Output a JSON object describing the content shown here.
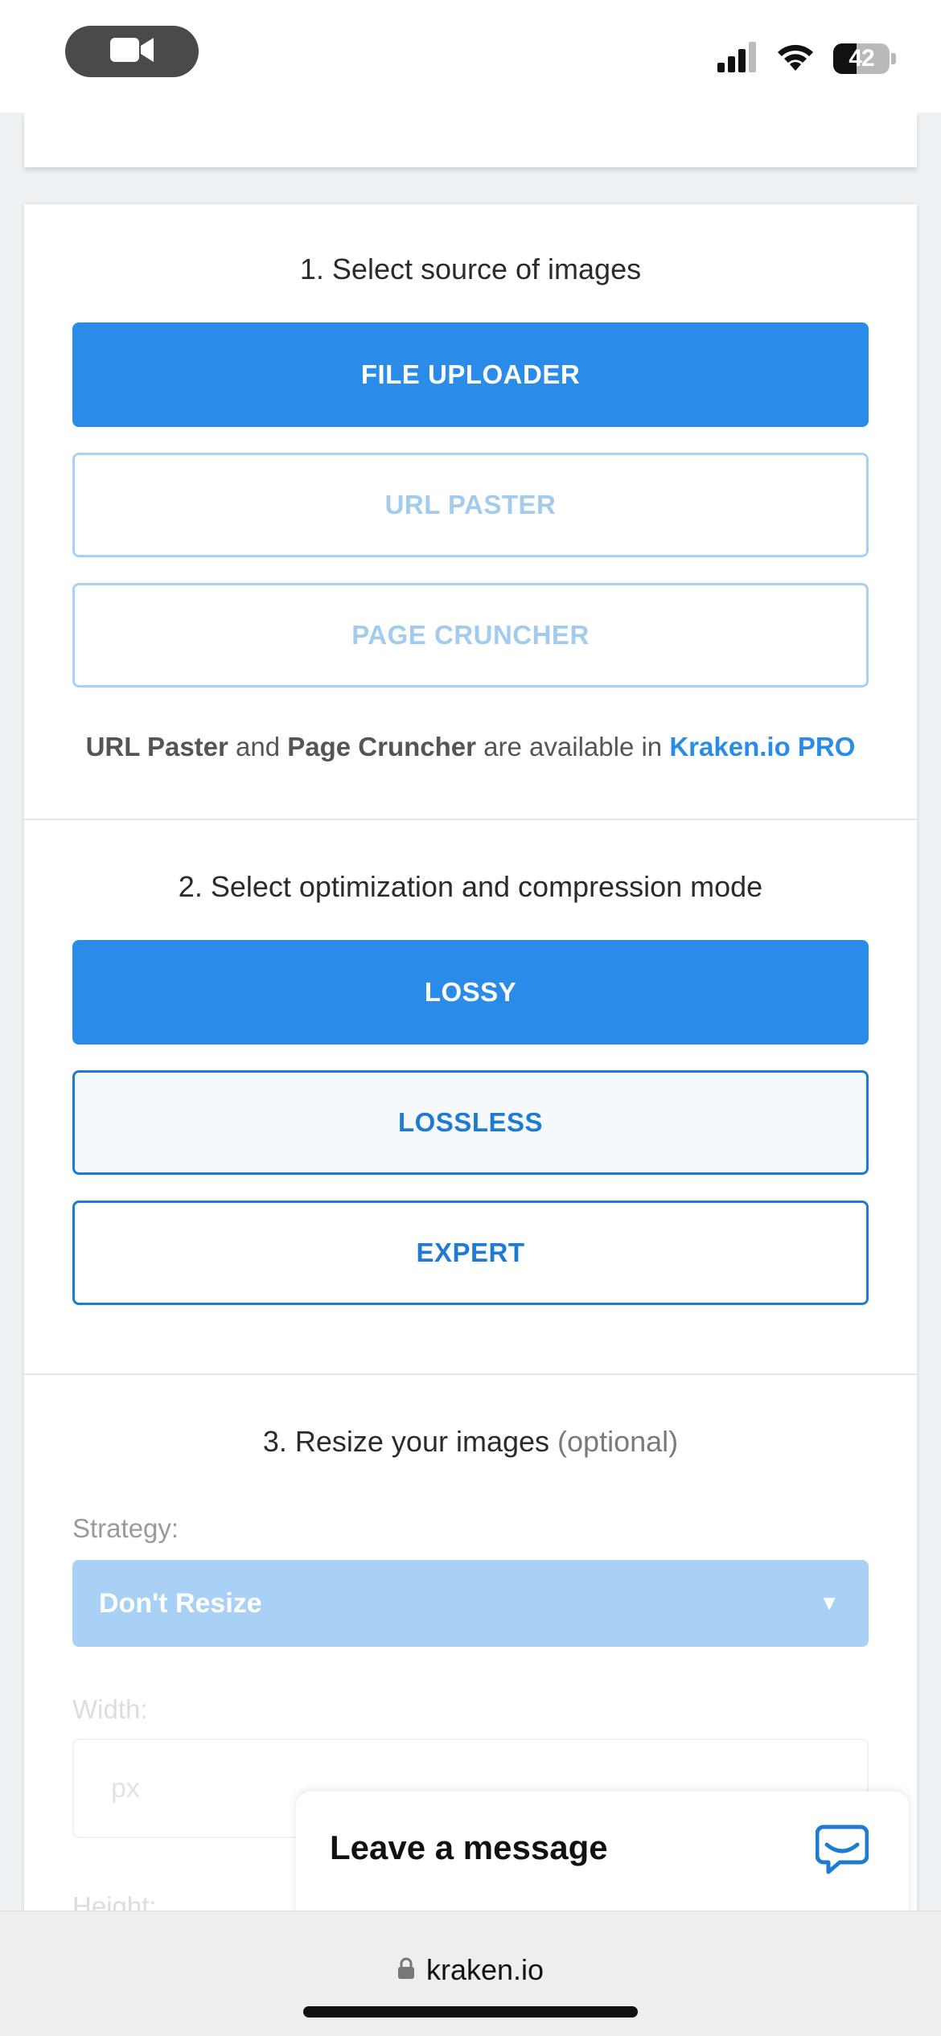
{
  "status_bar": {
    "battery_level": "42",
    "icons": [
      "video-camera-icon",
      "cellular-signal-icon",
      "wifi-icon",
      "battery-icon"
    ]
  },
  "section1": {
    "title": "1. Select source of images",
    "buttons": [
      "FILE UPLOADER",
      "URL PASTER",
      "PAGE CRUNCHER"
    ],
    "note_part1": "URL Paster",
    "note_part2": " and ",
    "note_part3": "Page Cruncher",
    "note_part4": " are available in ",
    "note_link": "Kraken.io PRO"
  },
  "section2": {
    "title": "2. Select optimization and compression mode",
    "buttons": [
      "LOSSY",
      "LOSSLESS",
      "EXPERT"
    ]
  },
  "section3": {
    "title": "3. Resize your images",
    "title_optional": "(optional)",
    "strategy_label": "Strategy:",
    "strategy_value": "Don't Resize",
    "width_label": "Width:",
    "width_placeholder": "px",
    "height_label": "Height:"
  },
  "chat": {
    "label": "Leave a message"
  },
  "browser": {
    "url": "kraken.io"
  },
  "colors": {
    "primary": "#2a8ce8",
    "outline": "#1f7bd2",
    "disabled": "#a9d1f3"
  }
}
